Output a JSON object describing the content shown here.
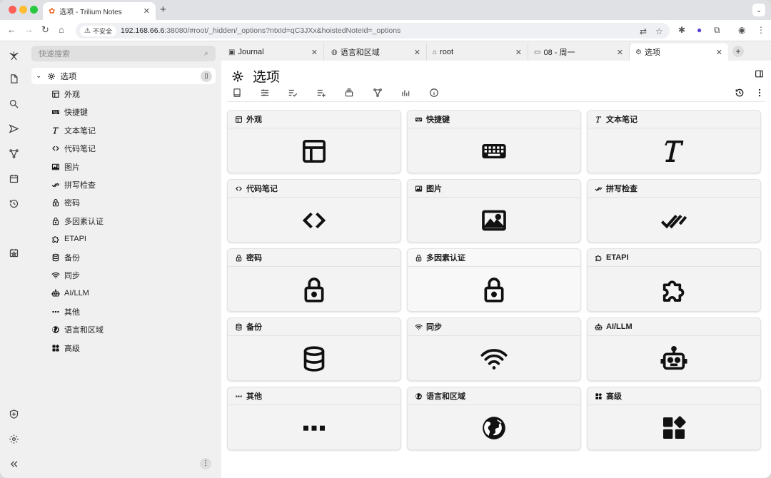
{
  "browser": {
    "tab_title": "选项 - Trilium Notes",
    "security_label": "不安全",
    "url_host": "192.168.66.6",
    "url_rest": ":38080/#root/_hidden/_options?ntxId=qC3JXx&hoistedNoteId=_options"
  },
  "search": {
    "placeholder": "快速搜索"
  },
  "tree": {
    "root_label": "选项",
    "items": [
      {
        "label": "外观",
        "icon": "layout-icon"
      },
      {
        "label": "快捷键",
        "icon": "keyboard-icon"
      },
      {
        "label": "文本笔记",
        "icon": "text-icon"
      },
      {
        "label": "代码笔记",
        "icon": "code-icon"
      },
      {
        "label": "图片",
        "icon": "image-icon"
      },
      {
        "label": "拼写检查",
        "icon": "double-check-icon"
      },
      {
        "label": "密码",
        "icon": "lock-icon"
      },
      {
        "label": "多因素认证",
        "icon": "lock-icon"
      },
      {
        "label": "ETAPI",
        "icon": "extension-icon"
      },
      {
        "label": "备份",
        "icon": "database-icon"
      },
      {
        "label": "同步",
        "icon": "wifi-icon"
      },
      {
        "label": "AI/LLM",
        "icon": "robot-icon"
      },
      {
        "label": "其他",
        "icon": "dots-icon"
      },
      {
        "label": "语言和区域",
        "icon": "globe-icon"
      },
      {
        "label": "高级",
        "icon": "widgets-icon"
      }
    ]
  },
  "note_tabs": [
    {
      "label": "Journal",
      "icon": "calendar-icon"
    },
    {
      "label": "语言和区域",
      "icon": "globe-icon"
    },
    {
      "label": "root",
      "icon": "home-icon"
    },
    {
      "label": "08 - 周一",
      "icon": "folder-icon"
    },
    {
      "label": "选项",
      "icon": "gear-icon"
    }
  ],
  "page": {
    "title": "选项"
  },
  "cards": [
    {
      "label": "外观",
      "icon": "layout-icon"
    },
    {
      "label": "快捷键",
      "icon": "keyboard-icon"
    },
    {
      "label": "文本笔记",
      "icon": "text-icon"
    },
    {
      "label": "代码笔记",
      "icon": "code-icon"
    },
    {
      "label": "图片",
      "icon": "image-icon"
    },
    {
      "label": "拼写检查",
      "icon": "double-check-icon"
    },
    {
      "label": "密码",
      "icon": "lock-icon"
    },
    {
      "label": "多因素认证",
      "icon": "lock-icon"
    },
    {
      "label": "ETAPI",
      "icon": "extension-icon"
    },
    {
      "label": "备份",
      "icon": "database-icon"
    },
    {
      "label": "同步",
      "icon": "wifi-icon"
    },
    {
      "label": "AI/LLM",
      "icon": "robot-icon"
    },
    {
      "label": "其他",
      "icon": "dots-icon"
    },
    {
      "label": "语言和区域",
      "icon": "globe-icon"
    },
    {
      "label": "高级",
      "icon": "widgets-icon"
    }
  ]
}
